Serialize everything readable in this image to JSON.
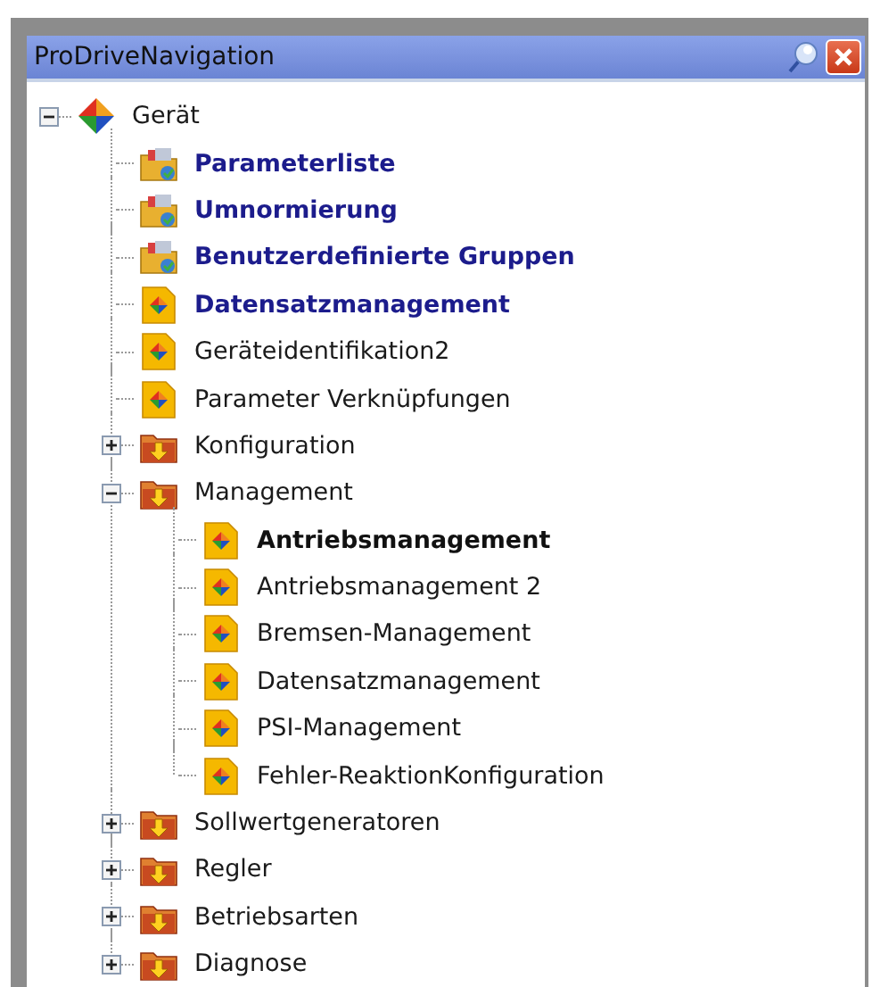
{
  "window": {
    "title": "ProDriveNavigation"
  },
  "tree": [
    {
      "label": "Gerät",
      "kind": "device",
      "emphasized": false,
      "selected": false,
      "expanded": true,
      "children": [
        {
          "label": "Parameterliste",
          "kind": "group",
          "emphasized": true,
          "selected": false
        },
        {
          "label": "Umnormierung",
          "kind": "group",
          "emphasized": true,
          "selected": false
        },
        {
          "label": "Benutzerdefinierte Gruppen",
          "kind": "group",
          "emphasized": true,
          "selected": false
        },
        {
          "label": "Datensatzmanagement",
          "kind": "document",
          "emphasized": true,
          "selected": false
        },
        {
          "label": "Geräteidentifikation2",
          "kind": "document",
          "emphasized": false,
          "selected": false
        },
        {
          "label": "Parameter Verknüpfungen",
          "kind": "document",
          "emphasized": false,
          "selected": false
        },
        {
          "label": "Konfiguration",
          "kind": "folder",
          "emphasized": false,
          "selected": false,
          "expanded": false
        },
        {
          "label": "Management",
          "kind": "folder",
          "emphasized": false,
          "selected": false,
          "expanded": true,
          "children": [
            {
              "label": "Antriebsmanagement",
              "kind": "document",
              "emphasized": false,
              "selected": true
            },
            {
              "label": "Antriebsmanagement 2",
              "kind": "document",
              "emphasized": false,
              "selected": false
            },
            {
              "label": "Bremsen-Management",
              "kind": "document",
              "emphasized": false,
              "selected": false
            },
            {
              "label": "Datensatzmanagement",
              "kind": "document",
              "emphasized": false,
              "selected": false
            },
            {
              "label": "PSI-Management",
              "kind": "document",
              "emphasized": false,
              "selected": false
            },
            {
              "label": "Fehler-ReaktionKonfiguration",
              "kind": "document",
              "emphasized": false,
              "selected": false
            }
          ]
        },
        {
          "label": "Sollwertgeneratoren",
          "kind": "folder",
          "emphasized": false,
          "selected": false,
          "expanded": false
        },
        {
          "label": "Regler",
          "kind": "folder",
          "emphasized": false,
          "selected": false,
          "expanded": false
        },
        {
          "label": "Betriebsarten",
          "kind": "folder",
          "emphasized": false,
          "selected": false,
          "expanded": false
        },
        {
          "label": "Diagnose",
          "kind": "folder",
          "emphasized": false,
          "selected": false,
          "expanded": false
        }
      ]
    }
  ]
}
